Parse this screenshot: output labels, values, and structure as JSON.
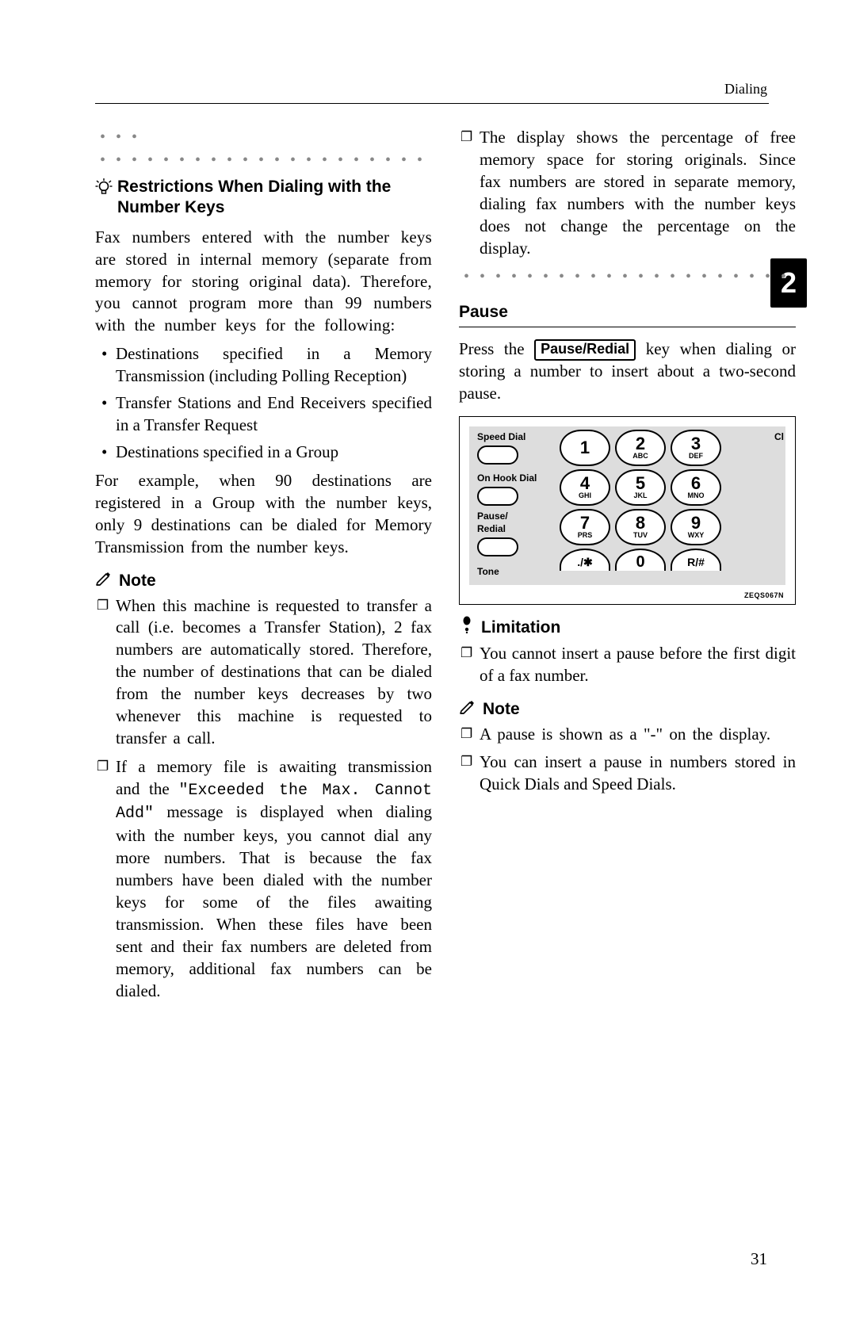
{
  "header": {
    "section": "Dialing"
  },
  "chapter_tab": "2",
  "page_number": "31",
  "left": {
    "dotted_lead": "• • •",
    "dotted_main": "• • • • • • • • • • • • • • • • • • • • • • • • •",
    "tip_heading": "Restrictions When Dialing with the Number Keys",
    "intro": "Fax numbers entered with the number keys are stored in internal memory (separate from memory for storing original data). Therefore, you cannot program more than 99 numbers with the number keys for the following:",
    "bullets": [
      "Destinations specified in a Memory Transmission (including Polling Reception)",
      "Transfer Stations and End Receivers specified in a Transfer Request",
      "Destinations specified in a Group"
    ],
    "example": "For example, when 90 destinations are registered in a Group with the number keys, only 9 destinations can be dialed for Memory Transmission from the number keys.",
    "note_label": "Note",
    "notes": [
      "When this machine is requested to transfer a call (i.e. becomes a Transfer Station), 2 fax numbers are automatically stored. Therefore, the number of destinations that can be dialed from the number keys decreases by two whenever this machine is requested to transfer a call.",
      "If a memory file is awaiting transmission and the \"Exceeded the Max. Cannot Add\" message is displayed when dialing with the number keys, you cannot dial any more numbers. That is because the fax numbers have been dialed with the number keys for some of the files awaiting transmission. When these files have been sent and their fax numbers are deleted from memory, additional fax numbers can be dialed."
    ],
    "note2_prefix": "If a memory file is awaiting transmission and the ",
    "note2_code": "\"Exceeded the Max. Cannot Add\"",
    "note2_suffix": " message is displayed when dialing with the number keys, you cannot dial any more numbers. That is because the fax numbers have been dialed with the number keys for some of the files awaiting transmission. When these files have been sent and their fax numbers are deleted from memory, additional fax numbers can be dialed."
  },
  "right": {
    "carry_over": "The display shows the percentage of free memory space for storing originals. Since fax numbers are stored in separate memory, dialing fax numbers with the number keys does not change the percentage on the display.",
    "dotted_end": "• • • • • • • • • • • • • • • • • • • • • • • • • •",
    "pause_heading": "Pause",
    "pause_text_pre": "Press the ",
    "pause_key": "Pause/Redial",
    "pause_text_post": " key when dialing or storing a number to insert about a two-second pause.",
    "limitation_label": "Limitation",
    "limitations": [
      "You cannot insert a pause before the first digit of a fax number."
    ],
    "note_label": "Note",
    "notes": [
      "A pause is shown as a \"-\" on the display.",
      "You can insert a pause in numbers stored in Quick Dials and Speed Dials."
    ]
  },
  "keypad": {
    "labels": {
      "speed_dial": "Speed Dial",
      "on_hook": "On Hook Dial",
      "pause_redial_1": "Pause/",
      "pause_redial_2": "Redial",
      "tone": "Tone",
      "cl": "Cl"
    },
    "keys": [
      {
        "num": "1",
        "sub": ""
      },
      {
        "num": "2",
        "sub": "ABC"
      },
      {
        "num": "3",
        "sub": "DEF"
      },
      {
        "num": "4",
        "sub": "GHI"
      },
      {
        "num": "5",
        "sub": "JKL"
      },
      {
        "num": "6",
        "sub": "MNO"
      },
      {
        "num": "7",
        "sub": "PRS"
      },
      {
        "num": "8",
        "sub": "TUV"
      },
      {
        "num": "9",
        "sub": "WXY"
      },
      {
        "num": "./✱",
        "sub": ""
      },
      {
        "num": "0",
        "sub": ""
      },
      {
        "num": "R/#",
        "sub": ""
      }
    ],
    "figure_code": "ZEQS067N"
  }
}
